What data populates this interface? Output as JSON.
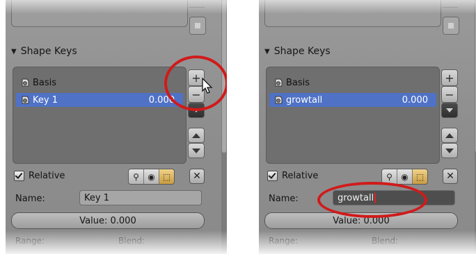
{
  "left": {
    "section_title": "Shape Keys",
    "items": [
      {
        "label": "Basis",
        "value": ""
      },
      {
        "label": "Key 1",
        "value": "0.000"
      }
    ],
    "relative_label": "Relative",
    "name_label": "Name:",
    "name_value": "Key 1",
    "value_slider": "Value: 0.000",
    "range_label": "Range:",
    "blend_label": "Blend:",
    "add_glyph": "+",
    "remove_glyph": "−",
    "close_glyph": "✕"
  },
  "right": {
    "section_title": "Shape Keys",
    "items": [
      {
        "label": "Basis",
        "value": ""
      },
      {
        "label": "growtall",
        "value": "0.000"
      }
    ],
    "relative_label": "Relative",
    "name_label": "Name:",
    "name_value": "growtall",
    "value_slider": "Value: 0.000",
    "range_label": "Range:",
    "blend_label": "Blend:",
    "add_glyph": "+",
    "remove_glyph": "−",
    "close_glyph": "✕"
  },
  "colors": {
    "selection": "#4f72c6",
    "annotation": "#d11a1a"
  },
  "icons": [
    "triangle-down-icon",
    "shape-key-icon",
    "pin-icon",
    "eye-icon",
    "edit-mode-icon",
    "close-icon",
    "cursor-arrow-icon"
  ]
}
